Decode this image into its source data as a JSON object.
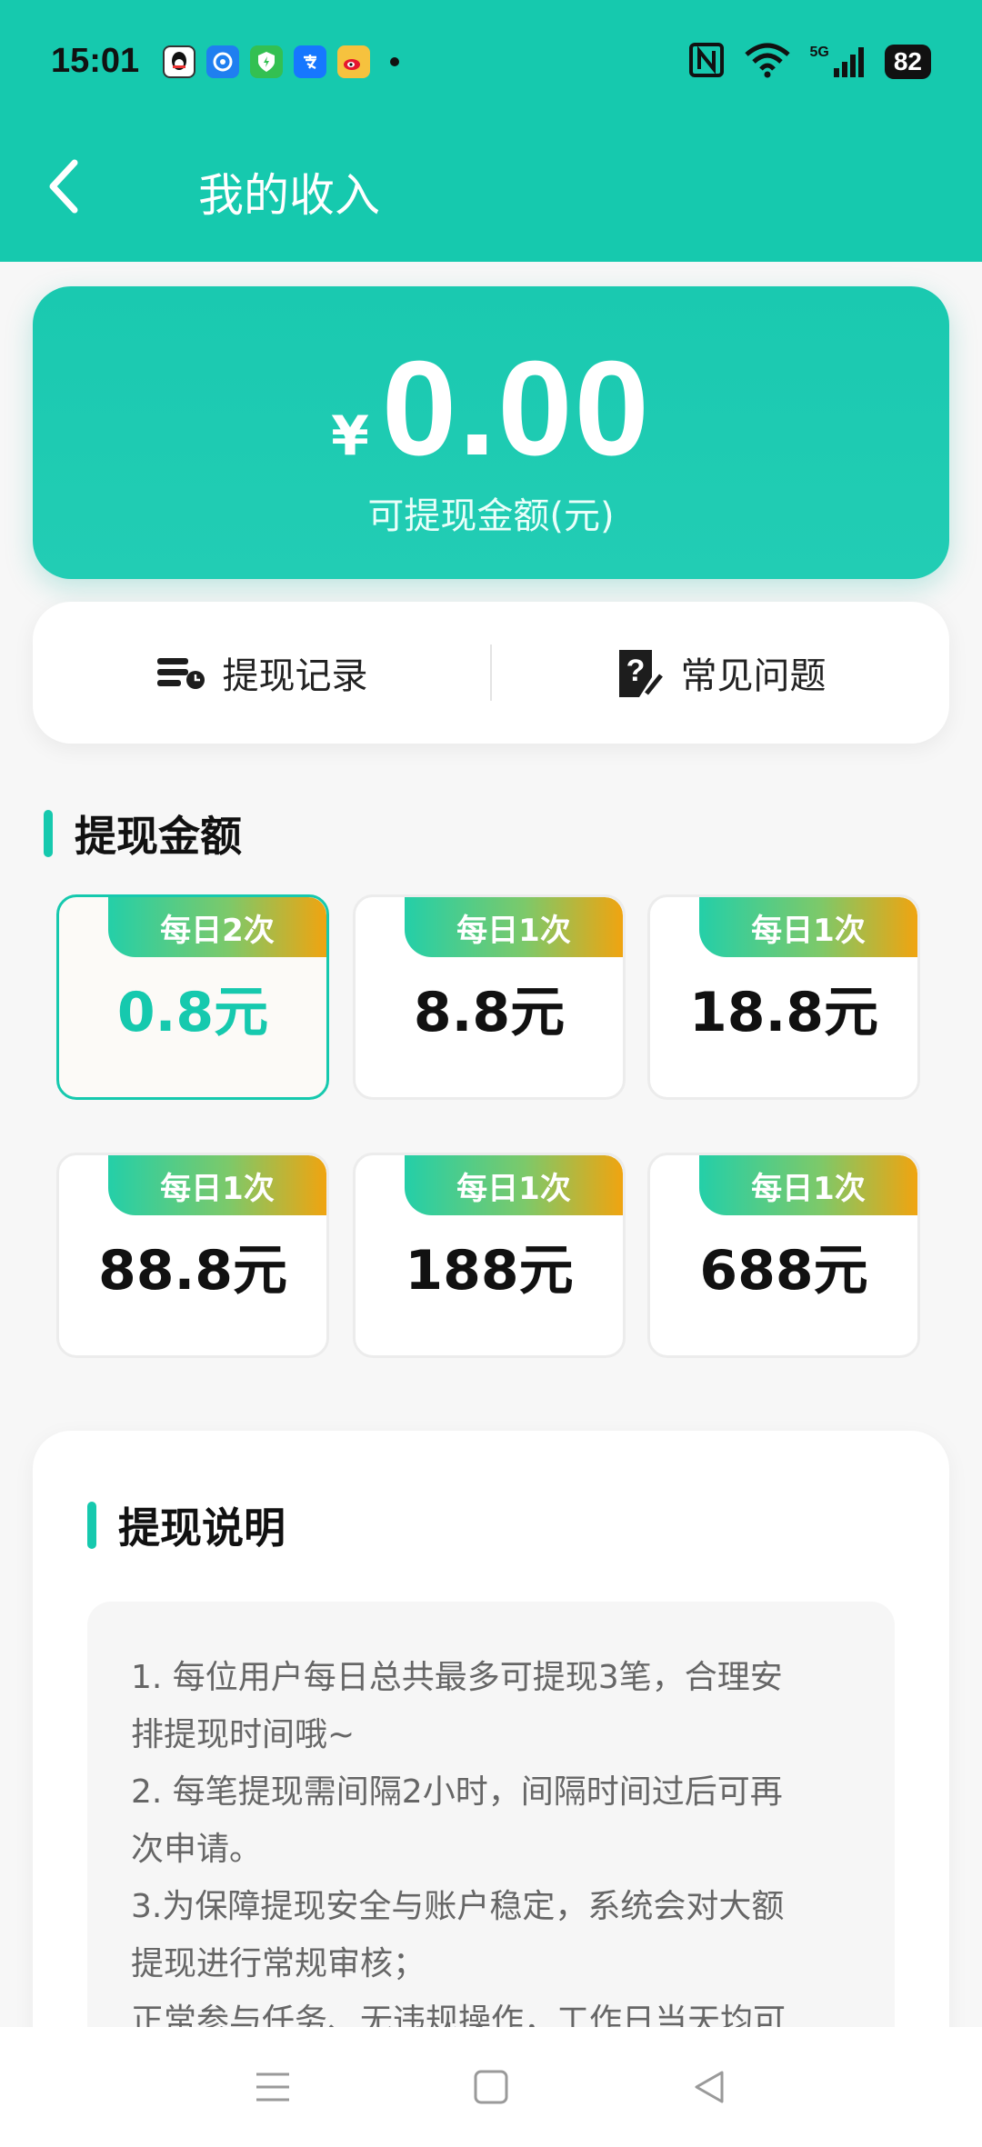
{
  "status_bar": {
    "time": "15:01",
    "apps": [
      "qq-icon",
      "pinwheel-icon",
      "shield-icon",
      "alipay-icon",
      "weibo-icon"
    ],
    "network": "5G",
    "battery": "82"
  },
  "header": {
    "title": "我的收入"
  },
  "balance": {
    "currency": "¥",
    "amount": "0.00",
    "label": "可提现金额(元)"
  },
  "actions": {
    "records_label": "提现记录",
    "faq_label": "常见问题"
  },
  "withdraw_section": {
    "title": "提现金额"
  },
  "options": [
    {
      "badge": "每日2次",
      "value": "0.8元",
      "selected": true
    },
    {
      "badge": "每日1次",
      "value": "8.8元",
      "selected": false
    },
    {
      "badge": "每日1次",
      "value": "18.8元",
      "selected": false
    },
    {
      "badge": "每日1次",
      "value": "88.8元",
      "selected": false
    },
    {
      "badge": "每日1次",
      "value": "188元",
      "selected": false
    },
    {
      "badge": "每日1次",
      "value": "688元",
      "selected": false
    }
  ],
  "instructions": {
    "title": "提现说明",
    "lines": [
      "1. 每位用户每日总共最多可提现3笔，合理安",
      "排提现时间哦~",
      "2. 每笔提现需间隔2小时，间隔时间过后可再",
      "次申请。",
      "3.为保障提现安全与账户稳定，系统会对大额",
      "提现进行常规审核；",
      "正常参与任务、无违规操作，工作日当天均可"
    ]
  },
  "colors": {
    "brand": "#16c9ae",
    "badge_gradient_end": "#f0a410"
  }
}
